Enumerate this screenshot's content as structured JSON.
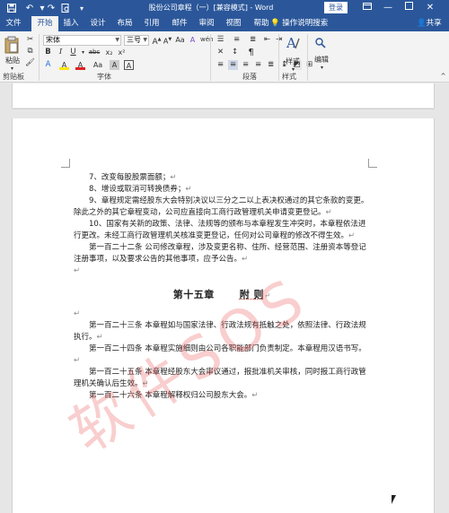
{
  "titlebar": {
    "title": "股份公司章程（一）[兼容模式] - Word",
    "login_label": "登录",
    "save_icon": "save-icon",
    "undo_icon": "undo-icon",
    "redo_icon": "redo-icon",
    "preview_icon": "print-preview-icon",
    "customize_icon": "customize-quick-access-icon",
    "ribbon_options_icon": "ribbon-display-options-icon",
    "minimize_icon": "minimize-icon",
    "restore_icon": "restore-icon",
    "close_icon": "close-icon"
  },
  "tabs": [
    {
      "label": "文件",
      "active": false
    },
    {
      "label": "开始",
      "active": true
    },
    {
      "label": "插入",
      "active": false
    },
    {
      "label": "设计",
      "active": false
    },
    {
      "label": "布局",
      "active": false
    },
    {
      "label": "引用",
      "active": false
    },
    {
      "label": "邮件",
      "active": false
    },
    {
      "label": "审阅",
      "active": false
    },
    {
      "label": "视图",
      "active": false
    },
    {
      "label": "帮助",
      "active": false
    }
  ],
  "tell_me": {
    "label": "操作说明搜索",
    "icon": "lightbulb-icon"
  },
  "share": {
    "label": "共享",
    "icon": "person-icon"
  },
  "ribbon": {
    "clipboard": {
      "paste_label": "粘贴",
      "group_label": "剪贴板"
    },
    "font": {
      "font_name": "宋体",
      "font_size": "三号",
      "group_label": "字体",
      "bold": "B",
      "italic": "I",
      "underline": "U",
      "strikethrough": "abc",
      "subscript": "x₂",
      "superscript": "x²",
      "font_color": "A",
      "highlight": "A",
      "change_case": "Aa",
      "grow": "A",
      "shrink": "A",
      "clear": "A",
      "phonetic": "wén",
      "char_border": "A"
    },
    "paragraph": {
      "group_label": "段落"
    },
    "styles": {
      "label": "样式",
      "group_label": "样式",
      "icon": "styles-icon"
    },
    "editing": {
      "label": "编辑",
      "icon": "find-icon"
    }
  },
  "document": {
    "paragraphs": [
      {
        "text": "7、改变每股股票面额；",
        "indent": true
      },
      {
        "text": "8、增设或取消可转换债券；",
        "indent": true
      },
      {
        "text": "9、章程规定需经股东大会特别决议以三分之二以上表决权通过的其它条款的变更。除此之外的其它章程变动，公司应直接向工商行政管理机关申请变更登记。",
        "indent": true
      },
      {
        "text": "10、国家有关新的政策、法律、法规等的颁布与本章程发生冲突时，本章程依法进行更改。未经工商行政管理机关核准变更登记，任何对公司章程的修改不得生效。",
        "indent": true
      },
      {
        "text": "第一百二十二条 公司修改章程，涉及变更名称、住所、经营范围、注册资本等登记注册事项，以及要求公告的其他事项，应予公告。",
        "indent": true
      },
      {
        "text": "",
        "indent": false
      }
    ],
    "heading": {
      "chapter": "第十五章",
      "title": "附 则"
    },
    "paragraphs2": [
      {
        "text": "",
        "indent": false
      },
      {
        "text": "第一百二十三条 本章程如与国家法律、行政法规有抵触之处，依照法律、行政法规执行。",
        "indent": true
      },
      {
        "text": "第一百二十四条 本章程实施细则由公司各职能部门负责制定。本章程用汉语书写。",
        "indent": true
      },
      {
        "text": "第一百二十五条 本章程经股东大会审议通过，报批准机关审核，同时报工商行政管理机关确认后生效。",
        "indent": true
      },
      {
        "text": "第一百二十六条 本章程解释权归公司股东大会。",
        "indent": true
      }
    ],
    "paragraph_mark": "↵",
    "watermark": "软件SOS"
  }
}
